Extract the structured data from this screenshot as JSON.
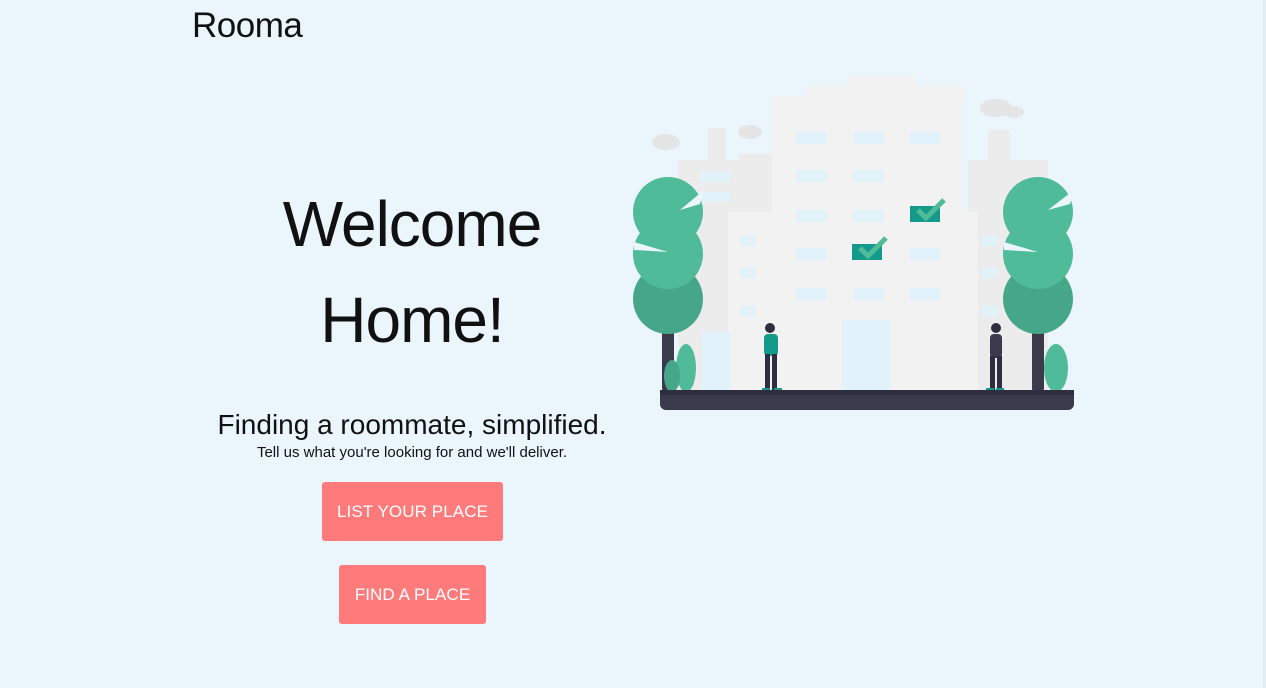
{
  "header": {
    "brand": "Rooma"
  },
  "hero": {
    "title_line1": "Welcome",
    "title_line2": "Home!",
    "tagline": "Finding a roommate, simplified.",
    "subtext": "Tell us what you're looking for and we'll deliver."
  },
  "actions": {
    "list_label": "LIST YOUR PLACE",
    "find_label": "FIND A PLACE"
  },
  "illustration": {
    "icon": "city-building-illustration",
    "colors": {
      "accent": "#ff7b7b",
      "tree": "#4fbb98",
      "tree_dark": "#45a788",
      "check": "#139a8a",
      "ground": "#3a3a4c",
      "building": "#f2f2f2",
      "background": "#eaf6fc"
    }
  }
}
